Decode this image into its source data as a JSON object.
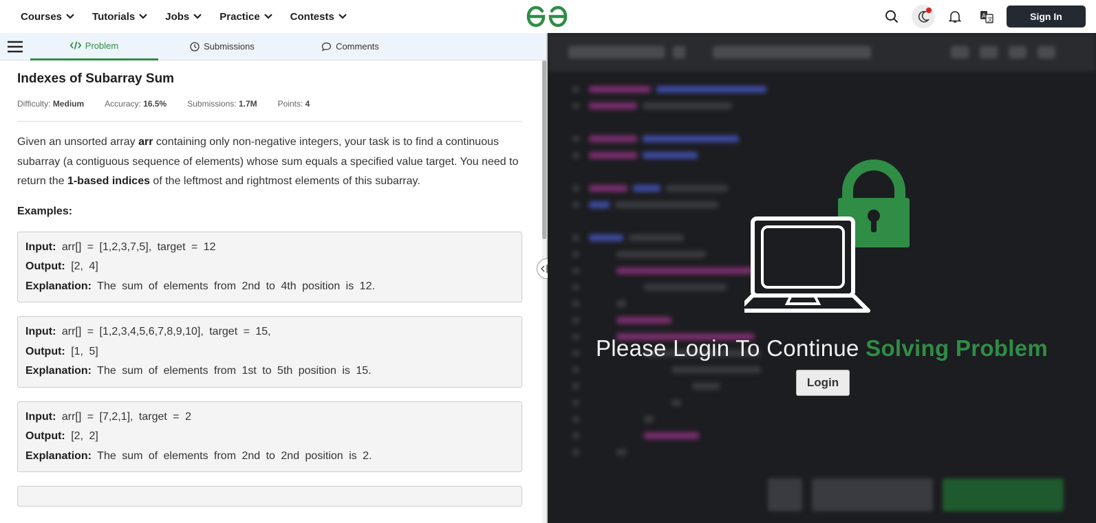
{
  "nav": {
    "menu": [
      {
        "label": "Courses"
      },
      {
        "label": "Tutorials"
      },
      {
        "label": "Jobs"
      },
      {
        "label": "Practice"
      },
      {
        "label": "Contests"
      }
    ],
    "sign_in": "Sign In",
    "brand_color": "#2f8d46"
  },
  "tabs": [
    {
      "label": "Problem",
      "icon": "code-icon",
      "active": true
    },
    {
      "label": "Submissions",
      "icon": "clock-icon",
      "active": false
    },
    {
      "label": "Comments",
      "icon": "comment-icon",
      "active": false
    }
  ],
  "problem": {
    "title": "Indexes of Subarray Sum",
    "difficulty_label": "Difficulty:",
    "difficulty": "Medium",
    "accuracy_label": "Accuracy:",
    "accuracy": "16.5%",
    "submissions_label": "Submissions:",
    "submissions": "1.7M",
    "points_label": "Points:",
    "points": "4",
    "desc_1": "Given an unsorted array ",
    "desc_bold_1": "arr",
    "desc_2": " containing only non-negative integers, your task is to find a continuous subarray (a contiguous sequence of elements) whose sum equals a specified value target. You need to return the ",
    "desc_bold_2": "1-based indices",
    "desc_3": " of the leftmost and rightmost elements of this subarray.",
    "examples_heading": "Examples:",
    "examples": [
      {
        "input_label": "Input:",
        "input": "arr[] = [1,2,3,7,5], target = 12",
        "output_label": "Output:",
        "output": "[2, 4]",
        "expl_label": "Explanation:",
        "explanation": "The sum of elements from 2nd to 4th position is 12."
      },
      {
        "input_label": "Input:",
        "input": "arr[] = [1,2,3,4,5,6,7,8,9,10], target = 15,",
        "output_label": "Output:",
        "output": "[1, 5]",
        "expl_label": "Explanation:",
        "explanation": "The sum of elements from 1st to 5th position is 15."
      },
      {
        "input_label": "Input:",
        "input": "arr[] = [7,2,1], target = 2",
        "output_label": "Output:",
        "output": "[2, 2]",
        "expl_label": "Explanation:",
        "explanation": "The sum of elements from 2nd to 2nd position is 2."
      }
    ]
  },
  "editor_overlay": {
    "message_plain": "Please Login To Continue ",
    "message_accent": "Solving Problem",
    "login_button": "Login"
  }
}
